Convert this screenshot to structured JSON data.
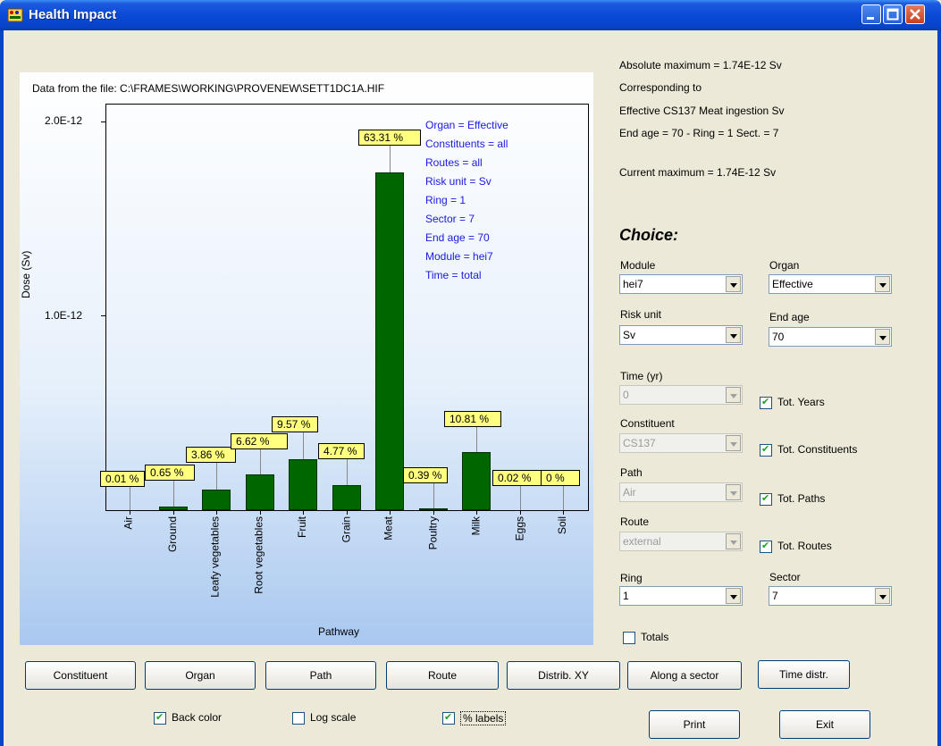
{
  "window": {
    "title": "Health Impact",
    "icon": "app-icon"
  },
  "plot": {
    "file_label": "Data from the file: C:\\FRAMES\\WORKING\\PROVENEW\\SETT1DC1A.HIF",
    "info_lines": [
      "Organ = Effective",
      "Constituents = all",
      "Routes = all",
      "Risk unit = Sv",
      "Ring = 1",
      "Sector = 7",
      "End age = 70",
      "Module = hei7",
      "Time = total"
    ]
  },
  "chart_data": {
    "type": "bar",
    "xlabel": "Pathway",
    "ylabel": "Dose (Sv)",
    "ytick_labels": [
      "2.0E-12",
      "1.0E-12"
    ],
    "ylim": [
      0,
      2e-12
    ],
    "categories": [
      "Air",
      "Ground",
      "Leafy vegetables",
      "Root vegetables",
      "Fruit",
      "Grain",
      "Meat",
      "Poultry",
      "Milk",
      "Eggs",
      "Soil"
    ],
    "values": [
      0.0,
      1.8e-14,
      1.06e-13,
      1.82e-13,
      2.63e-13,
      1.31e-13,
      1.74e-12,
      1.1e-14,
      2.97e-13,
      1e-15,
      0.0
    ],
    "percent_labels": [
      "0.01 %",
      "0.65 %",
      "3.86 %",
      "6.62 %",
      "9.57 %",
      "4.77 %",
      "63.31 %",
      "0.39 %",
      "10.81 %",
      "0.02 %",
      "0 %"
    ],
    "bar_color": "#006600"
  },
  "right": {
    "abs_max": "Absolute maximum = 1.74E-12 Sv",
    "corr": "Corresponding to",
    "corr_detail": "Effective  CS137  Meat ingestion  Sv",
    "end_ring": "End age = 70 -  Ring = 1  Sect. = 7",
    "cur_max": "Current maximum = 1.74E-12 Sv",
    "choice_title": "Choice:",
    "module_label": "Module",
    "module_value": "hei7",
    "organ_label": "Organ",
    "organ_value": "Effective",
    "risk_label": "Risk unit",
    "risk_value": "Sv",
    "endage_label": "End age",
    "endage_value": "70",
    "time_label": "Time (yr)",
    "time_value": "0",
    "constituent_label": "Constituent",
    "constituent_value": "CS137",
    "path_label": "Path",
    "path_value": "Air",
    "route_label": "Route",
    "route_value": "external",
    "ring_label": "Ring",
    "ring_value": "1",
    "sector_label": "Sector",
    "sector_value": "7",
    "tot_years": "Tot. Years",
    "tot_constituents": "Tot. Constituents",
    "tot_paths": "Tot. Paths",
    "tot_routes": "Tot. Routes",
    "totals": "Totals"
  },
  "buttons": {
    "constituent": "Constituent",
    "organ": "Organ",
    "path": "Path",
    "route": "Route",
    "distrib": "Distrib. XY",
    "along": "Along a sector",
    "time": "Time distr.",
    "print": "Print",
    "exit": "Exit"
  },
  "options": {
    "back_color": "Back color",
    "log_scale": "Log scale",
    "pct_labels": "% labels"
  }
}
